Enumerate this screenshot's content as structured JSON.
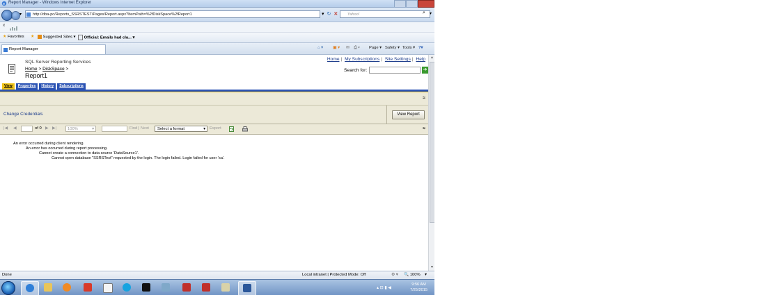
{
  "window": {
    "title": "Report Manager - Windows Internet Explorer"
  },
  "browser": {
    "url": "http://dba-pc/Reports_SSRSTEST/Pages/Report.aspx?ItemPath=%2fDiskSpace%2fReport1",
    "search_placeholder": "Yahoo!",
    "close_bar": "x",
    "favorites_label": "Favorites",
    "suggested_sites": "Suggested Sites ▾",
    "official_emails": "Official: Emails had cla... ▾",
    "tab_title": "Report Manager",
    "commands": {
      "page": "Page ▾",
      "safety": "Safety ▾",
      "tools": "Tools ▾",
      "help": "?▾"
    }
  },
  "rm": {
    "links": [
      "Home",
      "My Subscriptions",
      "Site Settings",
      "Help"
    ],
    "app_name": "SQL Server Reporting Services",
    "breadcrumb": [
      "Home",
      "DiskSpace"
    ],
    "crumb_sep": ">",
    "report_title": "Report1",
    "search_label": "Search for:",
    "go_icon": "➔",
    "tabs": [
      "View",
      "Properties",
      "History",
      "Subscriptions"
    ],
    "change_credentials": "Change Credentials",
    "view_report": "View Report",
    "collapse_glyph": "≈"
  },
  "toolbar": {
    "first": "|◀",
    "prev": "◀",
    "page_value": "",
    "of": "of 0",
    "next": "▶",
    "last": "▶|",
    "zoom": "100%",
    "zoom_arrow": "▾",
    "find": "Find",
    "sep": "|",
    "next_label": "Next",
    "format": "Select a format",
    "format_arrow": "▾",
    "export": "Export"
  },
  "errors": [
    "An error occurred during client rendering.",
    "An error has occurred during report processing.",
    "Cannot create a connection to data source 'DataSource1'.",
    "Cannot open database \"SSRSTest\" requested by the login. The login failed. Login failed for user 'sa'."
  ],
  "status": {
    "left": "Done",
    "zone": "Local intranet | Protected Mode: Off",
    "zoom": "🔍 100%",
    "zoom_arrow": "▾"
  },
  "taskbar": {
    "time": "9:56 AM",
    "date": "7/25/2015"
  },
  "colors": {
    "rm_blue": "#2a52b3",
    "rm_yellow": "#f0c419",
    "rm_beige": "#ece9d8"
  }
}
